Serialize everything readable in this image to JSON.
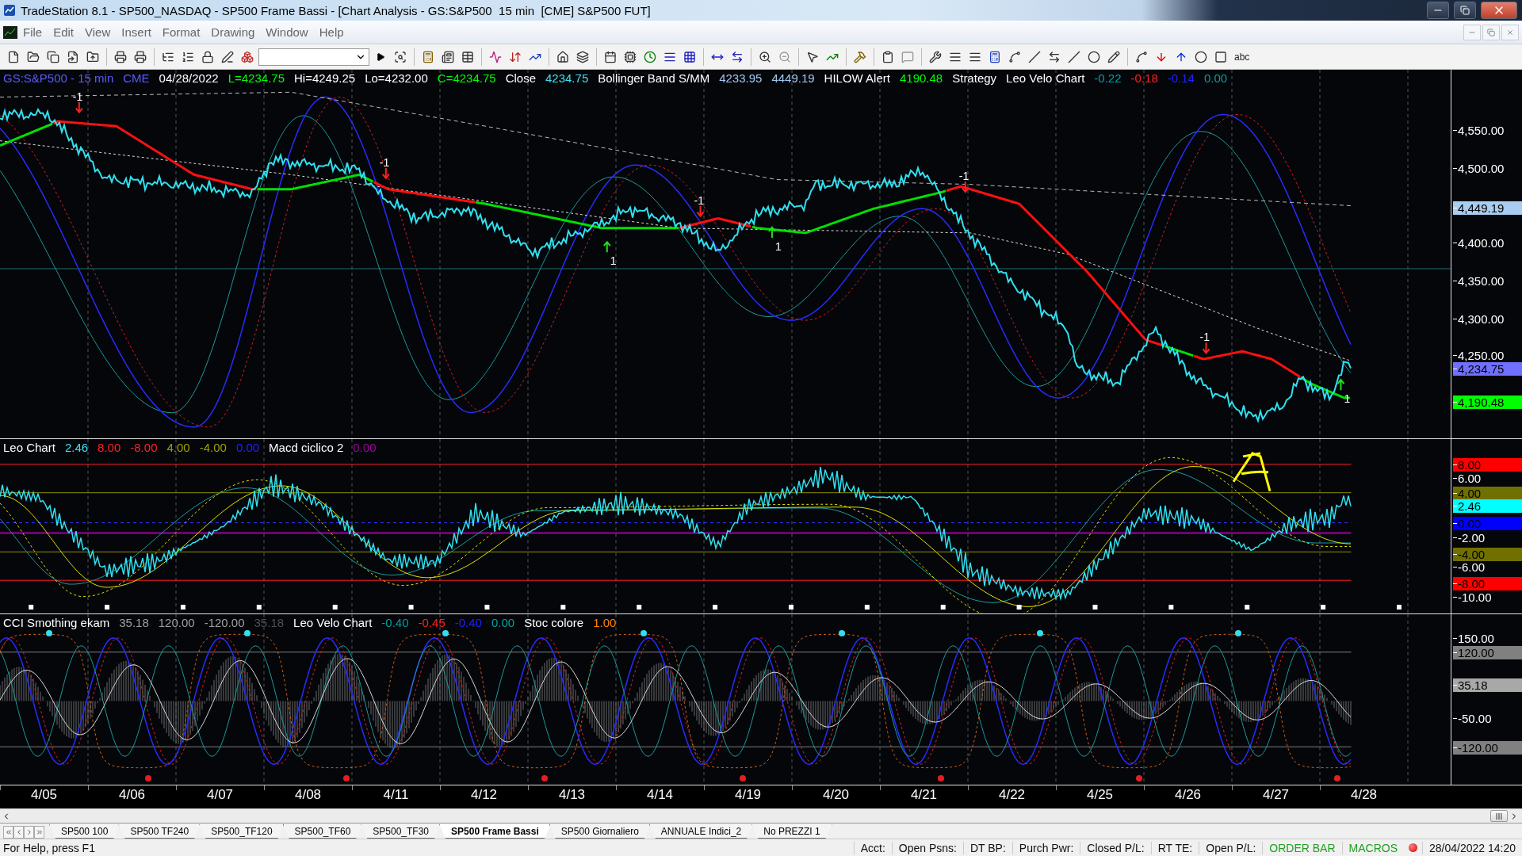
{
  "window": {
    "title": "TradeStation 8.1 - SP500_NASDAQ - SP500 Frame Bassi - [Chart Analysis - GS:S&P500  15 min  [CME] S&P500 FUT]"
  },
  "menu": [
    "File",
    "Edit",
    "View",
    "Insert",
    "Format",
    "Drawing",
    "Window",
    "Help"
  ],
  "toolbar": {
    "text_tool": "abc"
  },
  "panes": [
    {
      "legend": [
        {
          "text": "GS:S&P500 - 15 min",
          "color": "#5a5aff"
        },
        {
          "text": "CME",
          "color": "#5a5aff"
        },
        {
          "text": "04/28/2022",
          "color": "#ffffff"
        },
        {
          "text": "L=4234.75",
          "color": "#00ff00"
        },
        {
          "text": "Hi=4249.25",
          "color": "#ffffff"
        },
        {
          "text": "Lo=4232.00",
          "color": "#ffffff"
        },
        {
          "text": "C=4234.75",
          "color": "#00ff00"
        },
        {
          "text": "Close",
          "color": "#ffffff"
        },
        {
          "text": "4234.75",
          "color": "#40e0f0"
        },
        {
          "text": "Bollinger Band S/MM",
          "color": "#ffffff"
        },
        {
          "text": "4233.95",
          "color": "#a0c8f0"
        },
        {
          "text": "4449.19",
          "color": "#a0c8f0"
        },
        {
          "text": "HILOW Alert",
          "color": "#ffffff"
        },
        {
          "text": "4190.48",
          "color": "#00ff00"
        },
        {
          "text": "Strategy",
          "color": "#ffffff"
        },
        {
          "text": "Leo Velo Chart",
          "color": "#ffffff"
        },
        {
          "text": "-0.22",
          "color": "#00a0a0"
        },
        {
          "text": "-0.18",
          "color": "#ff2020"
        },
        {
          "text": "-0.14",
          "color": "#2020ff"
        },
        {
          "text": "0.00",
          "color": "#00a0a0"
        }
      ],
      "axis": [
        {
          "text": "4,550.00",
          "kind": "tick"
        },
        {
          "text": "4,500.00",
          "kind": "tick"
        },
        {
          "text": "4,449.19",
          "kind": "flag",
          "color": "#a8cdf0"
        },
        {
          "text": "4,400.00",
          "kind": "tick"
        },
        {
          "text": "4,350.00",
          "kind": "tick"
        },
        {
          "text": "4,300.00",
          "kind": "tick"
        },
        {
          "text": "4,250.00",
          "kind": "tick"
        },
        {
          "text": "4,234.75",
          "kind": "flag",
          "color": "#7070ff"
        },
        {
          "text": "4,190.48",
          "kind": "flag",
          "color": "#00ff00"
        }
      ],
      "signals": [
        {
          "text": "-1",
          "kind": "sell"
        },
        {
          "text": "-1",
          "kind": "sell"
        },
        {
          "text": "1",
          "kind": "buy"
        },
        {
          "text": "-1",
          "kind": "sell"
        },
        {
          "text": "1",
          "kind": "buy"
        },
        {
          "text": "-1",
          "kind": "sell"
        },
        {
          "text": "-1",
          "kind": "sell"
        },
        {
          "text": "1",
          "kind": "buy"
        }
      ]
    },
    {
      "legend": [
        {
          "text": "Leo Chart",
          "color": "#ffffff"
        },
        {
          "text": "2.46",
          "color": "#40e0f0"
        },
        {
          "text": "8.00",
          "color": "#ff2020"
        },
        {
          "text": "-8.00",
          "color": "#ff2020"
        },
        {
          "text": "4.00",
          "color": "#a0a000"
        },
        {
          "text": "-4.00",
          "color": "#a0a000"
        },
        {
          "text": "0.00",
          "color": "#2020ff"
        },
        {
          "text": "Macd ciclico 2",
          "color": "#ffffff"
        },
        {
          "text": "0.00",
          "color": "#a000a0"
        }
      ],
      "axis": [
        {
          "text": "8.00",
          "kind": "flag",
          "color": "#ff0000"
        },
        {
          "text": "6.00",
          "kind": "tick"
        },
        {
          "text": "4.00",
          "kind": "flag",
          "color": "#707000"
        },
        {
          "text": "2.46",
          "kind": "flag",
          "color": "#00ffff"
        },
        {
          "text": "0.00",
          "kind": "flag",
          "color": "#0000ff"
        },
        {
          "text": "-2.00",
          "kind": "tick"
        },
        {
          "text": "-4.00",
          "kind": "flag",
          "color": "#707000"
        },
        {
          "text": "-6.00",
          "kind": "tick"
        },
        {
          "text": "-8.00",
          "kind": "flag",
          "color": "#ff0000"
        },
        {
          "text": "-10.00",
          "kind": "tick"
        }
      ]
    },
    {
      "legend": [
        {
          "text": "CCI Smothing ekam",
          "color": "#ffffff"
        },
        {
          "text": "35.18",
          "color": "#a0a0a0"
        },
        {
          "text": "120.00",
          "color": "#a0a0a0"
        },
        {
          "text": "-120.00",
          "color": "#a0a0a0"
        },
        {
          "text": "35.18",
          "color": "#505050"
        },
        {
          "text": "Leo Velo Chart",
          "color": "#ffffff"
        },
        {
          "text": "-0.40",
          "color": "#00a0a0"
        },
        {
          "text": "-0.45",
          "color": "#ff2020"
        },
        {
          "text": "-0.40",
          "color": "#2020ff"
        },
        {
          "text": "0.00",
          "color": "#00a0a0"
        },
        {
          "text": "Stoc colore",
          "color": "#ffffff"
        },
        {
          "text": "1.00",
          "color": "#ff8000"
        }
      ],
      "axis": [
        {
          "text": "150.00",
          "kind": "tick"
        },
        {
          "text": "120.00",
          "kind": "flag",
          "color": "#808080"
        },
        {
          "text": "35.18",
          "kind": "flag",
          "color": "#a8a8a8"
        },
        {
          "text": "-50.00",
          "kind": "tick"
        },
        {
          "text": "-120.00",
          "kind": "flag",
          "color": "#808080"
        }
      ]
    }
  ],
  "x_axis": [
    "4/05",
    "4/06",
    "4/07",
    "4/08",
    "4/11",
    "4/12",
    "4/13",
    "4/14",
    "4/19",
    "4/20",
    "4/21",
    "4/22",
    "4/25",
    "4/26",
    "4/27",
    "4/28"
  ],
  "sheet_tabs": [
    {
      "label": "SP500 100",
      "selected": false
    },
    {
      "label": "SP500 TF240",
      "selected": false
    },
    {
      "label": "SP500_TF120",
      "selected": false
    },
    {
      "label": "SP500_TF60",
      "selected": false
    },
    {
      "label": "SP500_TF30",
      "selected": false
    },
    {
      "label": "SP500 Frame Bassi",
      "selected": true
    },
    {
      "label": "SP500 Giornaliero",
      "selected": false
    },
    {
      "label": "ANNUALE Indici_2",
      "selected": false
    },
    {
      "label": "No PREZZI 1",
      "selected": false
    }
  ],
  "status_bar": {
    "help": "For Help, press F1",
    "fields": [
      "Acct:",
      "Open Psns:",
      "DT BP:",
      "Purch Pwr:",
      "Closed P/L:",
      "RT TE:",
      "Open P/L:"
    ],
    "order_bar": "ORDER BAR",
    "macros": "MACROS",
    "datetime": "28/04/2022 14:20"
  }
}
